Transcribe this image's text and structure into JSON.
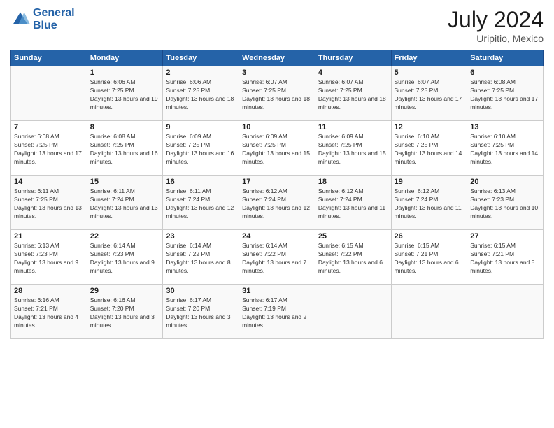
{
  "header": {
    "logo_line1": "General",
    "logo_line2": "Blue",
    "month_year": "July 2024",
    "location": "Uripitio, Mexico"
  },
  "days_of_week": [
    "Sunday",
    "Monday",
    "Tuesday",
    "Wednesday",
    "Thursday",
    "Friday",
    "Saturday"
  ],
  "weeks": [
    [
      {
        "day": "",
        "sunrise": "",
        "sunset": "",
        "daylight": ""
      },
      {
        "day": "1",
        "sunrise": "Sunrise: 6:06 AM",
        "sunset": "Sunset: 7:25 PM",
        "daylight": "Daylight: 13 hours and 19 minutes."
      },
      {
        "day": "2",
        "sunrise": "Sunrise: 6:06 AM",
        "sunset": "Sunset: 7:25 PM",
        "daylight": "Daylight: 13 hours and 18 minutes."
      },
      {
        "day": "3",
        "sunrise": "Sunrise: 6:07 AM",
        "sunset": "Sunset: 7:25 PM",
        "daylight": "Daylight: 13 hours and 18 minutes."
      },
      {
        "day": "4",
        "sunrise": "Sunrise: 6:07 AM",
        "sunset": "Sunset: 7:25 PM",
        "daylight": "Daylight: 13 hours and 18 minutes."
      },
      {
        "day": "5",
        "sunrise": "Sunrise: 6:07 AM",
        "sunset": "Sunset: 7:25 PM",
        "daylight": "Daylight: 13 hours and 17 minutes."
      },
      {
        "day": "6",
        "sunrise": "Sunrise: 6:08 AM",
        "sunset": "Sunset: 7:25 PM",
        "daylight": "Daylight: 13 hours and 17 minutes."
      }
    ],
    [
      {
        "day": "7",
        "sunrise": "Sunrise: 6:08 AM",
        "sunset": "Sunset: 7:25 PM",
        "daylight": "Daylight: 13 hours and 17 minutes."
      },
      {
        "day": "8",
        "sunrise": "Sunrise: 6:08 AM",
        "sunset": "Sunset: 7:25 PM",
        "daylight": "Daylight: 13 hours and 16 minutes."
      },
      {
        "day": "9",
        "sunrise": "Sunrise: 6:09 AM",
        "sunset": "Sunset: 7:25 PM",
        "daylight": "Daylight: 13 hours and 16 minutes."
      },
      {
        "day": "10",
        "sunrise": "Sunrise: 6:09 AM",
        "sunset": "Sunset: 7:25 PM",
        "daylight": "Daylight: 13 hours and 15 minutes."
      },
      {
        "day": "11",
        "sunrise": "Sunrise: 6:09 AM",
        "sunset": "Sunset: 7:25 PM",
        "daylight": "Daylight: 13 hours and 15 minutes."
      },
      {
        "day": "12",
        "sunrise": "Sunrise: 6:10 AM",
        "sunset": "Sunset: 7:25 PM",
        "daylight": "Daylight: 13 hours and 14 minutes."
      },
      {
        "day": "13",
        "sunrise": "Sunrise: 6:10 AM",
        "sunset": "Sunset: 7:25 PM",
        "daylight": "Daylight: 13 hours and 14 minutes."
      }
    ],
    [
      {
        "day": "14",
        "sunrise": "Sunrise: 6:11 AM",
        "sunset": "Sunset: 7:25 PM",
        "daylight": "Daylight: 13 hours and 13 minutes."
      },
      {
        "day": "15",
        "sunrise": "Sunrise: 6:11 AM",
        "sunset": "Sunset: 7:24 PM",
        "daylight": "Daylight: 13 hours and 13 minutes."
      },
      {
        "day": "16",
        "sunrise": "Sunrise: 6:11 AM",
        "sunset": "Sunset: 7:24 PM",
        "daylight": "Daylight: 13 hours and 12 minutes."
      },
      {
        "day": "17",
        "sunrise": "Sunrise: 6:12 AM",
        "sunset": "Sunset: 7:24 PM",
        "daylight": "Daylight: 13 hours and 12 minutes."
      },
      {
        "day": "18",
        "sunrise": "Sunrise: 6:12 AM",
        "sunset": "Sunset: 7:24 PM",
        "daylight": "Daylight: 13 hours and 11 minutes."
      },
      {
        "day": "19",
        "sunrise": "Sunrise: 6:12 AM",
        "sunset": "Sunset: 7:24 PM",
        "daylight": "Daylight: 13 hours and 11 minutes."
      },
      {
        "day": "20",
        "sunrise": "Sunrise: 6:13 AM",
        "sunset": "Sunset: 7:23 PM",
        "daylight": "Daylight: 13 hours and 10 minutes."
      }
    ],
    [
      {
        "day": "21",
        "sunrise": "Sunrise: 6:13 AM",
        "sunset": "Sunset: 7:23 PM",
        "daylight": "Daylight: 13 hours and 9 minutes."
      },
      {
        "day": "22",
        "sunrise": "Sunrise: 6:14 AM",
        "sunset": "Sunset: 7:23 PM",
        "daylight": "Daylight: 13 hours and 9 minutes."
      },
      {
        "day": "23",
        "sunrise": "Sunrise: 6:14 AM",
        "sunset": "Sunset: 7:22 PM",
        "daylight": "Daylight: 13 hours and 8 minutes."
      },
      {
        "day": "24",
        "sunrise": "Sunrise: 6:14 AM",
        "sunset": "Sunset: 7:22 PM",
        "daylight": "Daylight: 13 hours and 7 minutes."
      },
      {
        "day": "25",
        "sunrise": "Sunrise: 6:15 AM",
        "sunset": "Sunset: 7:22 PM",
        "daylight": "Daylight: 13 hours and 6 minutes."
      },
      {
        "day": "26",
        "sunrise": "Sunrise: 6:15 AM",
        "sunset": "Sunset: 7:21 PM",
        "daylight": "Daylight: 13 hours and 6 minutes."
      },
      {
        "day": "27",
        "sunrise": "Sunrise: 6:15 AM",
        "sunset": "Sunset: 7:21 PM",
        "daylight": "Daylight: 13 hours and 5 minutes."
      }
    ],
    [
      {
        "day": "28",
        "sunrise": "Sunrise: 6:16 AM",
        "sunset": "Sunset: 7:21 PM",
        "daylight": "Daylight: 13 hours and 4 minutes."
      },
      {
        "day": "29",
        "sunrise": "Sunrise: 6:16 AM",
        "sunset": "Sunset: 7:20 PM",
        "daylight": "Daylight: 13 hours and 3 minutes."
      },
      {
        "day": "30",
        "sunrise": "Sunrise: 6:17 AM",
        "sunset": "Sunset: 7:20 PM",
        "daylight": "Daylight: 13 hours and 3 minutes."
      },
      {
        "day": "31",
        "sunrise": "Sunrise: 6:17 AM",
        "sunset": "Sunset: 7:19 PM",
        "daylight": "Daylight: 13 hours and 2 minutes."
      },
      {
        "day": "",
        "sunrise": "",
        "sunset": "",
        "daylight": ""
      },
      {
        "day": "",
        "sunrise": "",
        "sunset": "",
        "daylight": ""
      },
      {
        "day": "",
        "sunrise": "",
        "sunset": "",
        "daylight": ""
      }
    ]
  ]
}
